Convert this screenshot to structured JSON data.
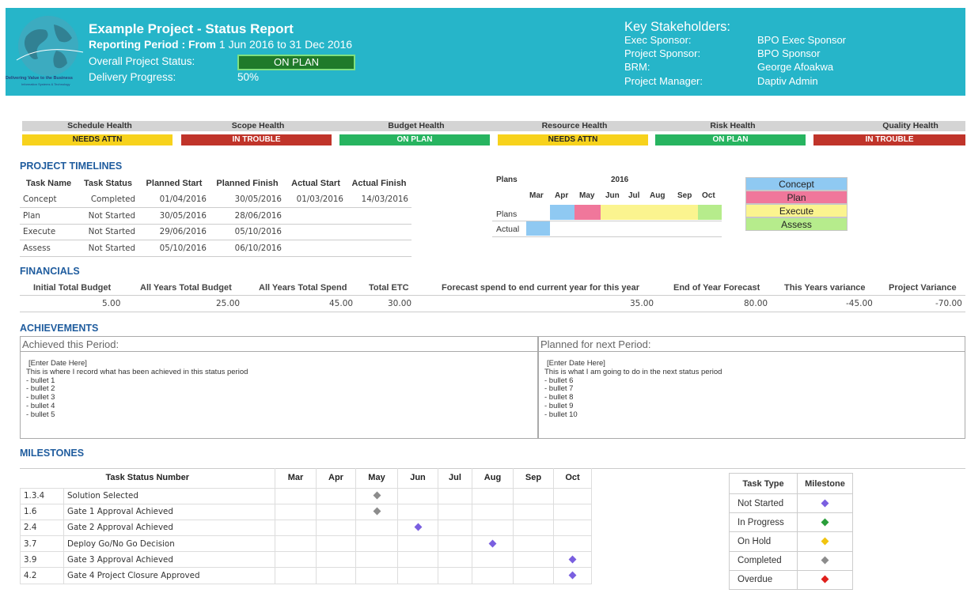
{
  "header": {
    "logo_line1": "Delivering Value to the Business",
    "logo_line2": "Information Systems & Technology",
    "title": "Example Project - Status Report",
    "period_label": "Reporting Period : From",
    "period_value": "1 Jun 2016 to 31 Dec 2016",
    "overall_label": "Overall Project Status:",
    "overall_value": "ON PLAN",
    "progress_label": "Delivery Progress:",
    "progress_value": "50%",
    "stakeholders_title": "Key Stakeholders:",
    "stakeholders": [
      {
        "role": "Exec Sponsor:",
        "name": "BPO Exec Sponsor"
      },
      {
        "role": "Project Sponsor:",
        "name": "BPO Sponsor"
      },
      {
        "role": "BRM:",
        "name": "George Afoakwa"
      },
      {
        "role": "Project Manager:",
        "name": "Daptiv Admin"
      }
    ]
  },
  "health": [
    {
      "label": "Schedule Health",
      "status": "NEEDS ATTN",
      "color": "#f7d21c"
    },
    {
      "label": "Scope Health",
      "status": "IN TROUBLE",
      "color": "#c0342a"
    },
    {
      "label": "Budget Health",
      "status": "ON PLAN",
      "color": "#27b460"
    },
    {
      "label": "Resource Health",
      "status": "NEEDS ATTN",
      "color": "#f7d21c"
    },
    {
      "label": "Risk Health",
      "status": "ON PLAN",
      "color": "#27b460"
    },
    {
      "label": "Quality Health",
      "status": "IN TROUBLE",
      "color": "#c0342a"
    }
  ],
  "timelines": {
    "title": "PROJECT TIMELINES",
    "columns": [
      "Task Name",
      "Task Status",
      "Planned Start",
      "Planned Finish",
      "Actual Start",
      "Actual Finish"
    ],
    "rows": [
      [
        "Concept",
        "Completed",
        "01/04/2016",
        "30/05/2016",
        "01/03/2016",
        "14/03/2016"
      ],
      [
        "Plan",
        "Not Started",
        "30/05/2016",
        "28/06/2016",
        "",
        ""
      ],
      [
        "Execute",
        "Not Started",
        "29/06/2016",
        "05/10/2016",
        "",
        ""
      ],
      [
        "Assess",
        "Not Started",
        "05/10/2016",
        "06/10/2016",
        "",
        ""
      ]
    ],
    "gantt": {
      "plans_label": "Plans",
      "year": "2016",
      "months": [
        "Mar",
        "Apr",
        "May",
        "Jun",
        "Jul",
        "Aug",
        "Sep",
        "Oct"
      ],
      "row_labels": [
        "Plans",
        "Actual"
      ]
    },
    "legend": [
      {
        "label": "Concept",
        "color": "#8fc9f2"
      },
      {
        "label": "Plan",
        "color": "#f0779b"
      },
      {
        "label": "Execute",
        "color": "#fbf48f"
      },
      {
        "label": "Assess",
        "color": "#b6ec8c"
      }
    ]
  },
  "financials": {
    "title": "FINANCIALS",
    "headers": [
      "Initial Total Budget",
      "All Years Total Budget",
      "All Years Total Spend",
      "Total ETC",
      "Forecast spend to end current year for this year",
      "End of Year Forecast",
      "This Years variance",
      "Project Variance"
    ],
    "values": [
      "5.00",
      "25.00",
      "45.00",
      "30.00",
      "35.00",
      "80.00",
      "-45.00",
      "-70.00"
    ]
  },
  "achievements": {
    "title": "ACHIEVEMENTS",
    "left_header": "Achieved this Period:",
    "left_lines": [
      "[Enter Date Here]",
      "This is where I record what has been achieved in this status period",
      "- bullet 1",
      "- bullet 2",
      "- bullet 3",
      "- bullet 4",
      "- bullet 5"
    ],
    "right_header": "Planned for next Period:",
    "right_lines": [
      "[Enter Date Here]",
      "This is what I am going to do in the next status period",
      "- bullet 6",
      "- bullet 7",
      "- bullet 8",
      "- bullet 9",
      "- bullet 10"
    ]
  },
  "milestones": {
    "title": "MILESTONES",
    "header": "Task Status Number",
    "months": [
      "Mar",
      "Apr",
      "May",
      "Jun",
      "Jul",
      "Aug",
      "Sep",
      "Oct"
    ],
    "rows": [
      {
        "num": "1.3.4",
        "name": "Solution Selected",
        "month": "May",
        "type": "Completed"
      },
      {
        "num": "1.6",
        "name": "Gate 1 Approval Achieved",
        "month": "May",
        "type": "Completed"
      },
      {
        "num": "2.4",
        "name": "Gate 2 Approval Achieved",
        "month": "Jun",
        "type": "Not Started"
      },
      {
        "num": "3.7",
        "name": "Deploy Go/No Go Decision",
        "month": "Aug",
        "type": "Not Started"
      },
      {
        "num": "3.9",
        "name": "Gate 3 Approval Achieved",
        "month": "Oct",
        "type": "Not Started"
      },
      {
        "num": "4.2",
        "name": "Gate 4 Project Closure Approved",
        "month": "Oct",
        "type": "Not Started"
      }
    ],
    "type_table": {
      "headers": [
        "Task Type",
        "Milestone"
      ],
      "rows": [
        {
          "label": "Not Started",
          "color": "#7a5fe0"
        },
        {
          "label": "In Progress",
          "color": "#2a9e3a"
        },
        {
          "label": "On Hold",
          "color": "#f1c40f"
        },
        {
          "label": "Completed",
          "color": "#8c8c8c"
        },
        {
          "label": "Overdue",
          "color": "#e0201c"
        }
      ]
    }
  }
}
